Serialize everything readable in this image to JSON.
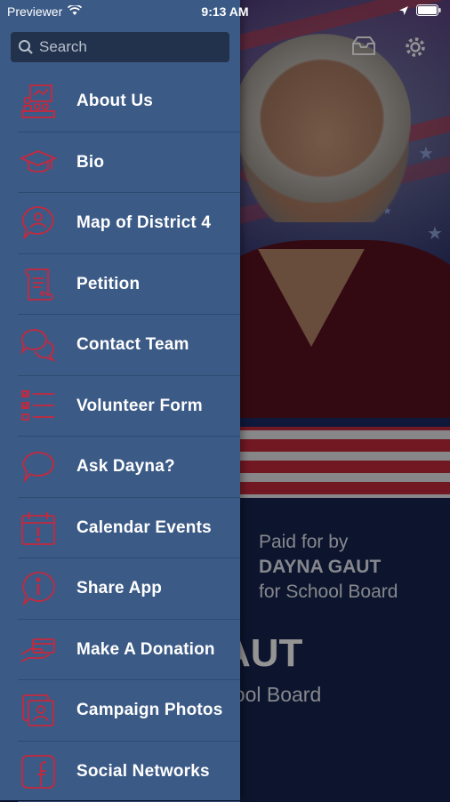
{
  "status_bar": {
    "carrier": "Previewer",
    "time": "9:13 AM"
  },
  "search": {
    "placeholder": "Search"
  },
  "menu": [
    {
      "label": "About Us",
      "icon": "classroom-icon"
    },
    {
      "label": "Bio",
      "icon": "graduation-cap-icon"
    },
    {
      "label": "Map of District 4",
      "icon": "person-chat-icon"
    },
    {
      "label": "Petition",
      "icon": "scroll-icon"
    },
    {
      "label": "Contact Team",
      "icon": "chat-bubbles-icon"
    },
    {
      "label": "Volunteer Form",
      "icon": "checklist-icon"
    },
    {
      "label": "Ask Dayna?",
      "icon": "speech-bubble-icon"
    },
    {
      "label": "Calendar Events",
      "icon": "calendar-alert-icon"
    },
    {
      "label": "Share App",
      "icon": "info-bubble-icon"
    },
    {
      "label": "Make A Donation",
      "icon": "hand-card-icon"
    },
    {
      "label": "Campaign Photos",
      "icon": "photos-icon"
    },
    {
      "label": "Social Networks",
      "icon": "facebook-icon"
    }
  ],
  "background": {
    "paid_line1": "Paid for by",
    "paid_line2": "DAYNA GAUT",
    "paid_line3": "for School Board",
    "name_partial": "AUT",
    "subtitle_partial": "hool Board"
  },
  "colors": {
    "drawer": "#3b5a86",
    "icon_accent": "#c8283c",
    "search_bg": "#23324c"
  }
}
